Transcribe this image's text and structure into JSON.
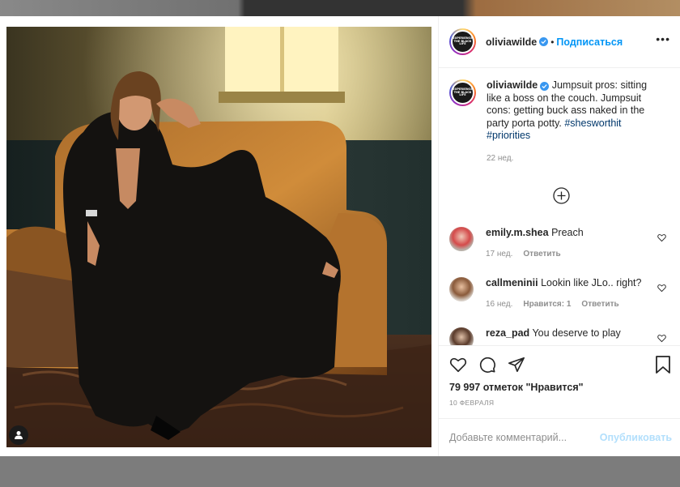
{
  "post": {
    "username": "oliviawilde",
    "follow_label": "Подписаться",
    "dot": "•",
    "more": "•••",
    "avatar_text": "EXPERIENCE THE BLACK LIFE",
    "caption": "Jumpsuit pros: sitting like a boss on the couch. Jumpsuit cons: getting buck ass naked in the party porta potty.",
    "hashtag_1": "#shesworthit",
    "hashtag_2": "#priorities",
    "caption_time": "22 нед.",
    "likes": "79 997 отметок \"Нравится\"",
    "date": "10 ФЕВРАЛЯ"
  },
  "comments": [
    {
      "user": "emily.m.shea",
      "text": "Preach",
      "time": "17 нед.",
      "likes": "",
      "reply": "Ответить"
    },
    {
      "user": "callmeninii",
      "text": "Lookin like JLo.. right?",
      "time": "16 нед.",
      "likes": "Нравится: 1",
      "reply": "Ответить"
    },
    {
      "user": "reza_pad",
      "text": "You deserve to play"
    }
  ],
  "composer": {
    "placeholder": "Добавьте комментарий...",
    "submit_label": "Опубликовать"
  },
  "icons": {
    "user_tag": "user-tag-icon",
    "verified": "verified-badge-icon",
    "load_more": "plus-circle-icon",
    "like": "heart-icon",
    "comment": "comment-icon",
    "share": "paper-plane-icon",
    "save": "bookmark-icon"
  },
  "colors": {
    "accent": "#0095f6",
    "verified": "#3897f0",
    "submit_disabled": "#b2dffc",
    "muted": "#8e8e8e"
  }
}
